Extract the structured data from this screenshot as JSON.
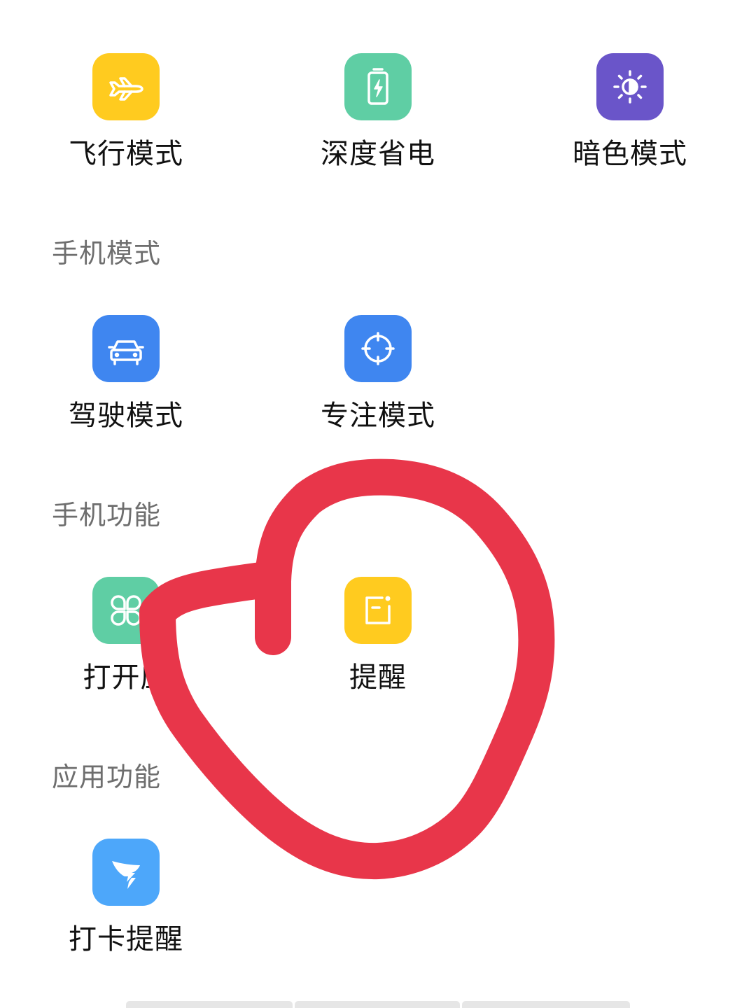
{
  "top_row": [
    {
      "label": "飞行模式",
      "icon": "airplane-icon",
      "color": "#FFCB1F"
    },
    {
      "label": "深度省电",
      "icon": "battery-icon",
      "color": "#5FCEA4"
    },
    {
      "label": "暗色模式",
      "icon": "brightness-icon",
      "color": "#6A55C9"
    }
  ],
  "sections": {
    "phone_modes": {
      "title": "手机模式",
      "items": [
        {
          "label": "驾驶模式",
          "icon": "car-icon",
          "color": "#3F86F0"
        },
        {
          "label": "专注模式",
          "icon": "crosshair-icon",
          "color": "#3F86F0"
        }
      ]
    },
    "phone_functions": {
      "title": "手机功能",
      "items": [
        {
          "label": "打开应",
          "icon": "apps-grid-icon",
          "color": "#5FCEA4"
        },
        {
          "label": "提醒",
          "icon": "memo-icon",
          "color": "#FFCB1F"
        }
      ]
    },
    "app_functions": {
      "title": "应用功能",
      "items": [
        {
          "label": "打卡提醒",
          "icon": "dingtalk-icon",
          "color": "#4DA7FA"
        }
      ]
    }
  },
  "annotation": {
    "color": "#E8364A",
    "icon": "hand-drawn-circle"
  }
}
